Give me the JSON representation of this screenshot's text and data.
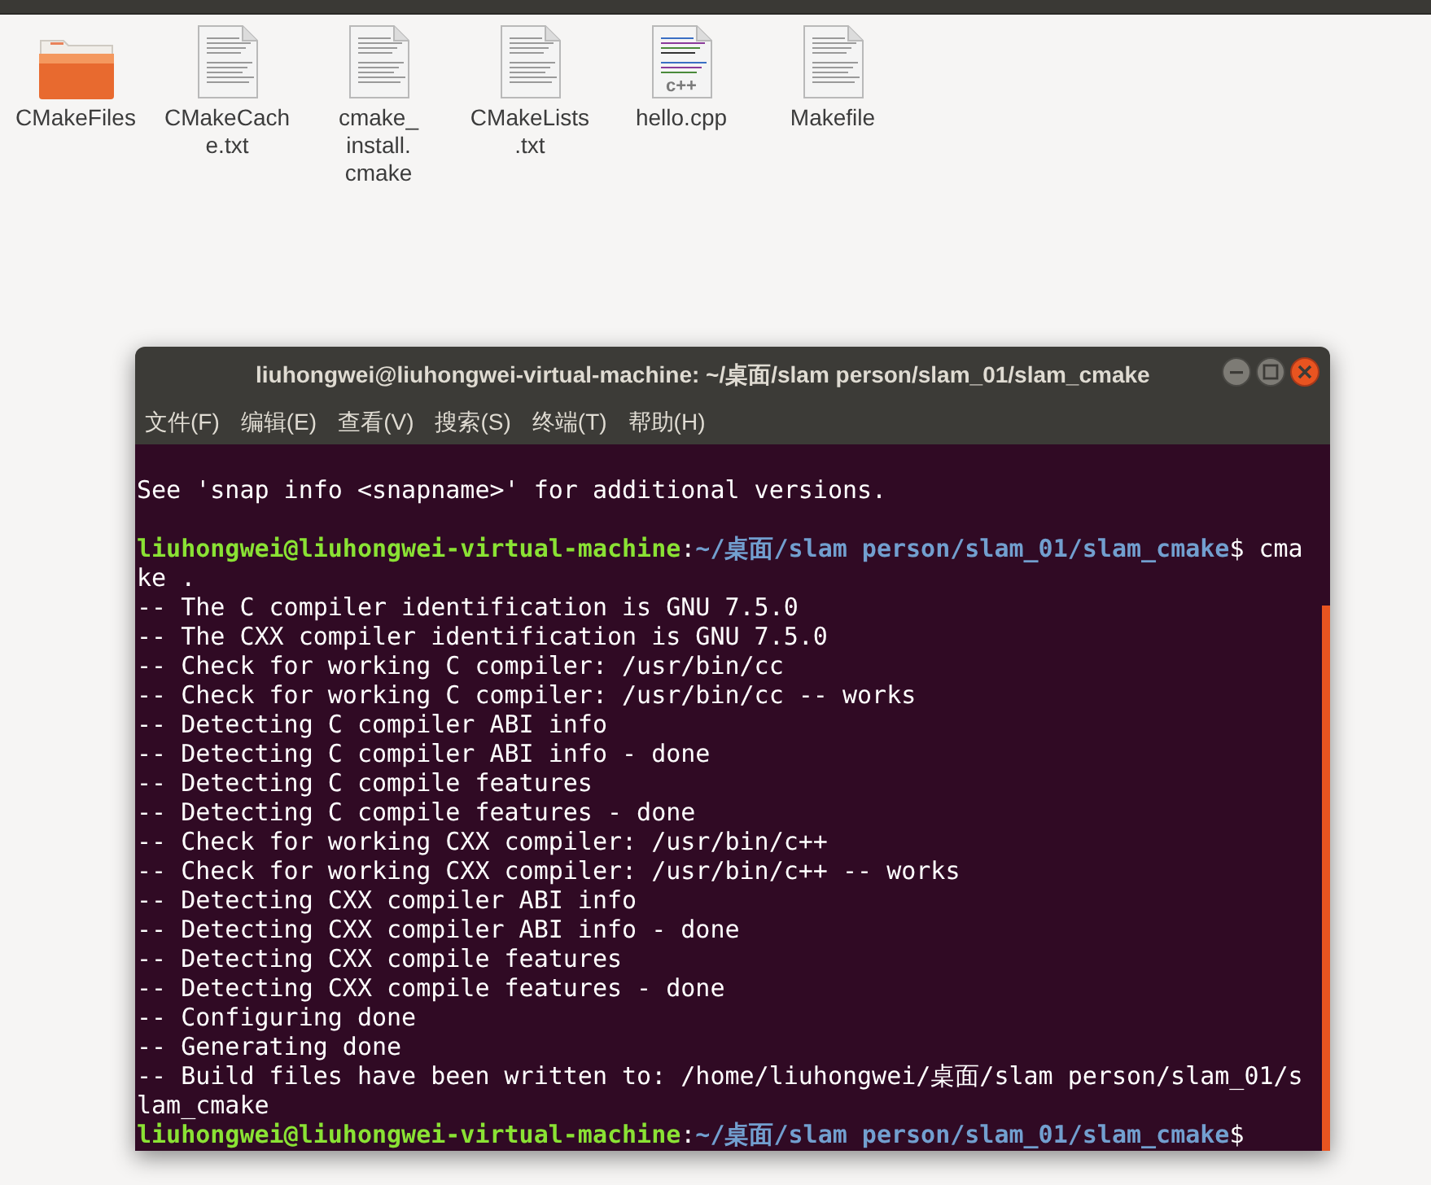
{
  "files": [
    {
      "kind": "folder",
      "name": "CMakeFiles"
    },
    {
      "kind": "text",
      "name": "CMakeCach e.txt"
    },
    {
      "kind": "text",
      "name": "cmake_ install. cmake"
    },
    {
      "kind": "text",
      "name": "CMakeLists .txt"
    },
    {
      "kind": "cpp",
      "name": "hello.cpp",
      "badge": "c++"
    },
    {
      "kind": "text",
      "name": "Makefile"
    }
  ],
  "terminal": {
    "title": "liuhongwei@liuhongwei-virtual-machine: ~/桌面/slam person/slam_01/slam_cmake",
    "menu": [
      "文件(F)",
      "编辑(E)",
      "查看(V)",
      "搜索(S)",
      "终端(T)",
      "帮助(H)"
    ],
    "lines": [
      {
        "kind": "output",
        "text": "See 'snap info <snapname>' for additional versions."
      },
      {
        "kind": "blank"
      },
      {
        "kind": "prompt",
        "user": "liuhongwei@liuhongwei-virtual-machine",
        "sep": ":",
        "path": "~/桌面/slam person/slam_01/slam_cmake",
        "command": "$ cma"
      },
      {
        "kind": "output",
        "text": "ke ."
      },
      {
        "kind": "output",
        "text": "-- The C compiler identification is GNU 7.5.0"
      },
      {
        "kind": "output",
        "text": "-- The CXX compiler identification is GNU 7.5.0"
      },
      {
        "kind": "output",
        "text": "-- Check for working C compiler: /usr/bin/cc"
      },
      {
        "kind": "output",
        "text": "-- Check for working C compiler: /usr/bin/cc -- works"
      },
      {
        "kind": "output",
        "text": "-- Detecting C compiler ABI info"
      },
      {
        "kind": "output",
        "text": "-- Detecting C compiler ABI info - done"
      },
      {
        "kind": "output",
        "text": "-- Detecting C compile features"
      },
      {
        "kind": "output",
        "text": "-- Detecting C compile features - done"
      },
      {
        "kind": "output",
        "text": "-- Check for working CXX compiler: /usr/bin/c++"
      },
      {
        "kind": "output",
        "text": "-- Check for working CXX compiler: /usr/bin/c++ -- works"
      },
      {
        "kind": "output",
        "text": "-- Detecting CXX compiler ABI info"
      },
      {
        "kind": "output",
        "text": "-- Detecting CXX compiler ABI info - done"
      },
      {
        "kind": "output",
        "text": "-- Detecting CXX compile features"
      },
      {
        "kind": "output",
        "text": "-- Detecting CXX compile features - done"
      },
      {
        "kind": "output",
        "text": "-- Configuring done"
      },
      {
        "kind": "output",
        "text": "-- Generating done"
      },
      {
        "kind": "output",
        "text": "-- Build files have been written to: /home/liuhongwei/桌面/slam person/slam_01/s"
      },
      {
        "kind": "output",
        "text": "lam_cmake"
      },
      {
        "kind": "prompt",
        "user": "liuhongwei@liuhongwei-virtual-machine",
        "sep": ":",
        "path": "~/桌面/slam person/slam_01/slam_cmake",
        "command": "$"
      }
    ]
  }
}
